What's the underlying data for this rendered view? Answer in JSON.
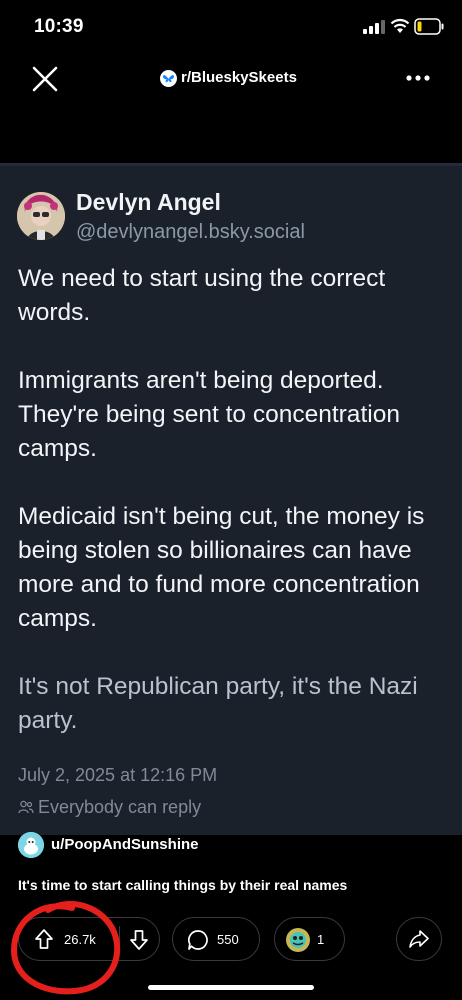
{
  "status_bar": {
    "time": "10:39"
  },
  "nav": {
    "subreddit": "r/BlueskySkeets"
  },
  "post": {
    "author_name": "Devlyn Angel",
    "author_handle": "@devlynangel.bsky.social",
    "paragraphs": [
      "We need to start using the correct words.",
      "Immigrants aren't being deported. They're being sent to concentration camps.",
      "Medicaid isn't being cut, the money is being stolen so billionaires can have more and to fund more concentration camps.",
      "It's not Republican party, it's the Nazi party."
    ],
    "date": "July 2, 2025 at 12:16 PM",
    "reply_setting": "Everybody can reply"
  },
  "reddit": {
    "username": "u/PoopAndSunshine",
    "title": "It's time to start calling things by their real names"
  },
  "actions": {
    "upvotes": "26.7k",
    "comments": "550",
    "awards": "1"
  },
  "colors": {
    "card_bg": "#1a212b",
    "annotation_red": "#e5201c",
    "bluesky_blue": "#1185fe"
  }
}
